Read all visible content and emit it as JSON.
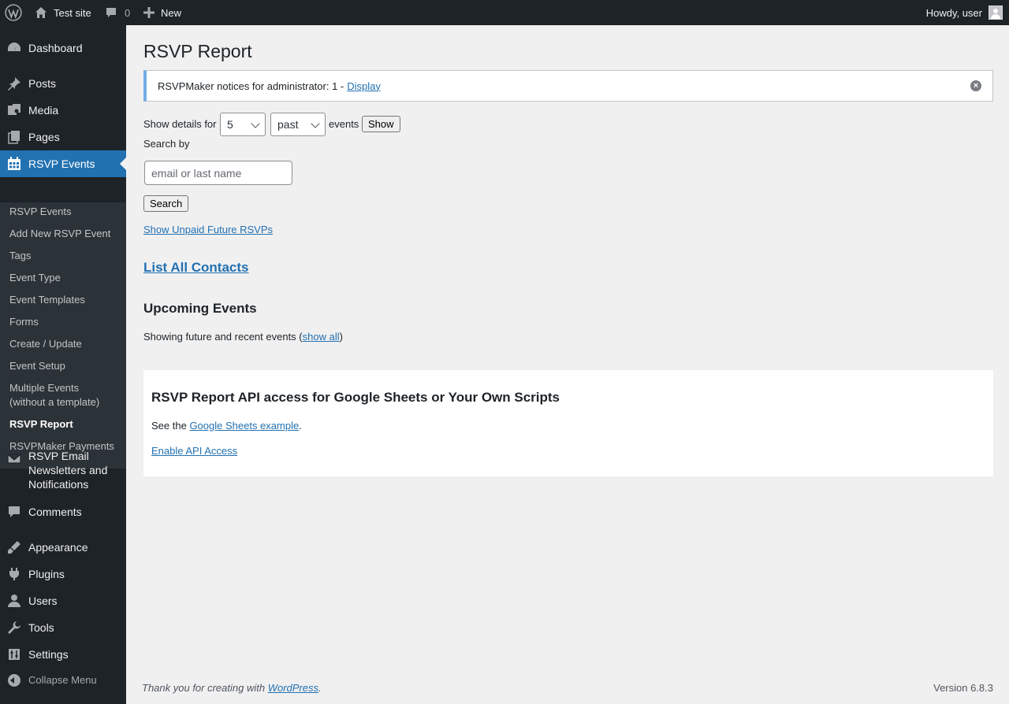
{
  "adminbar": {
    "site_name": "Test site",
    "comments_count": "0",
    "new_label": "New",
    "howdy": "Howdy, user"
  },
  "sidebar": {
    "items": [
      {
        "label": "Dashboard",
        "icon": "dashboard-icon"
      },
      {
        "label": "Posts",
        "icon": "pin-icon"
      },
      {
        "label": "Media",
        "icon": "media-icon"
      },
      {
        "label": "Pages",
        "icon": "pages-icon"
      },
      {
        "label": "RSVP Events",
        "icon": "calendar-icon"
      },
      {
        "label": "RSVP Email Newsletters and Notifications",
        "icon": "email-icon"
      },
      {
        "label": "Comments",
        "icon": "comment-icon"
      },
      {
        "label": "Appearance",
        "icon": "brush-icon"
      },
      {
        "label": "Plugins",
        "icon": "plugin-icon"
      },
      {
        "label": "Users",
        "icon": "user-icon"
      },
      {
        "label": "Tools",
        "icon": "wrench-icon"
      },
      {
        "label": "Settings",
        "icon": "settings-icon"
      }
    ],
    "submenu": [
      "RSVP Events",
      "Add New RSVP Event",
      "Tags",
      "Event Type",
      "Event Templates",
      "Forms",
      "Create / Update",
      "Event Setup",
      "Multiple Events (without a template)",
      "RSVP Report",
      "RSVPMaker Payments"
    ],
    "collapse_label": "Collapse Menu"
  },
  "main": {
    "title": "RSVP Report",
    "notice_text": "RSVPMaker notices for administrator: 1 - ",
    "notice_link": "Display",
    "show_details_label": "Show details for",
    "count_value": "5",
    "period_value": "past",
    "events_label": "events",
    "show_button": "Show",
    "search_by_label": "Search by",
    "search_placeholder": "email or last name",
    "search_button": "Search",
    "unpaid_link": "Show Unpaid Future RSVPs",
    "list_contacts_link": "List All Contacts",
    "upcoming_heading": "Upcoming Events",
    "upcoming_text": "Showing future and recent events (",
    "show_all_link": "show all",
    "upcoming_close": ")",
    "api_heading": "RSVP Report API access for Google Sheets or Your Own Scripts",
    "api_text_pre": "See the ",
    "api_link": "Google Sheets example",
    "api_text_post": ".",
    "enable_api_link": "Enable API Access"
  },
  "footer": {
    "thanks_pre": "Thank you for creating with ",
    "thanks_link": "WordPress",
    "thanks_post": ".",
    "version": "Version 6.8.3"
  }
}
